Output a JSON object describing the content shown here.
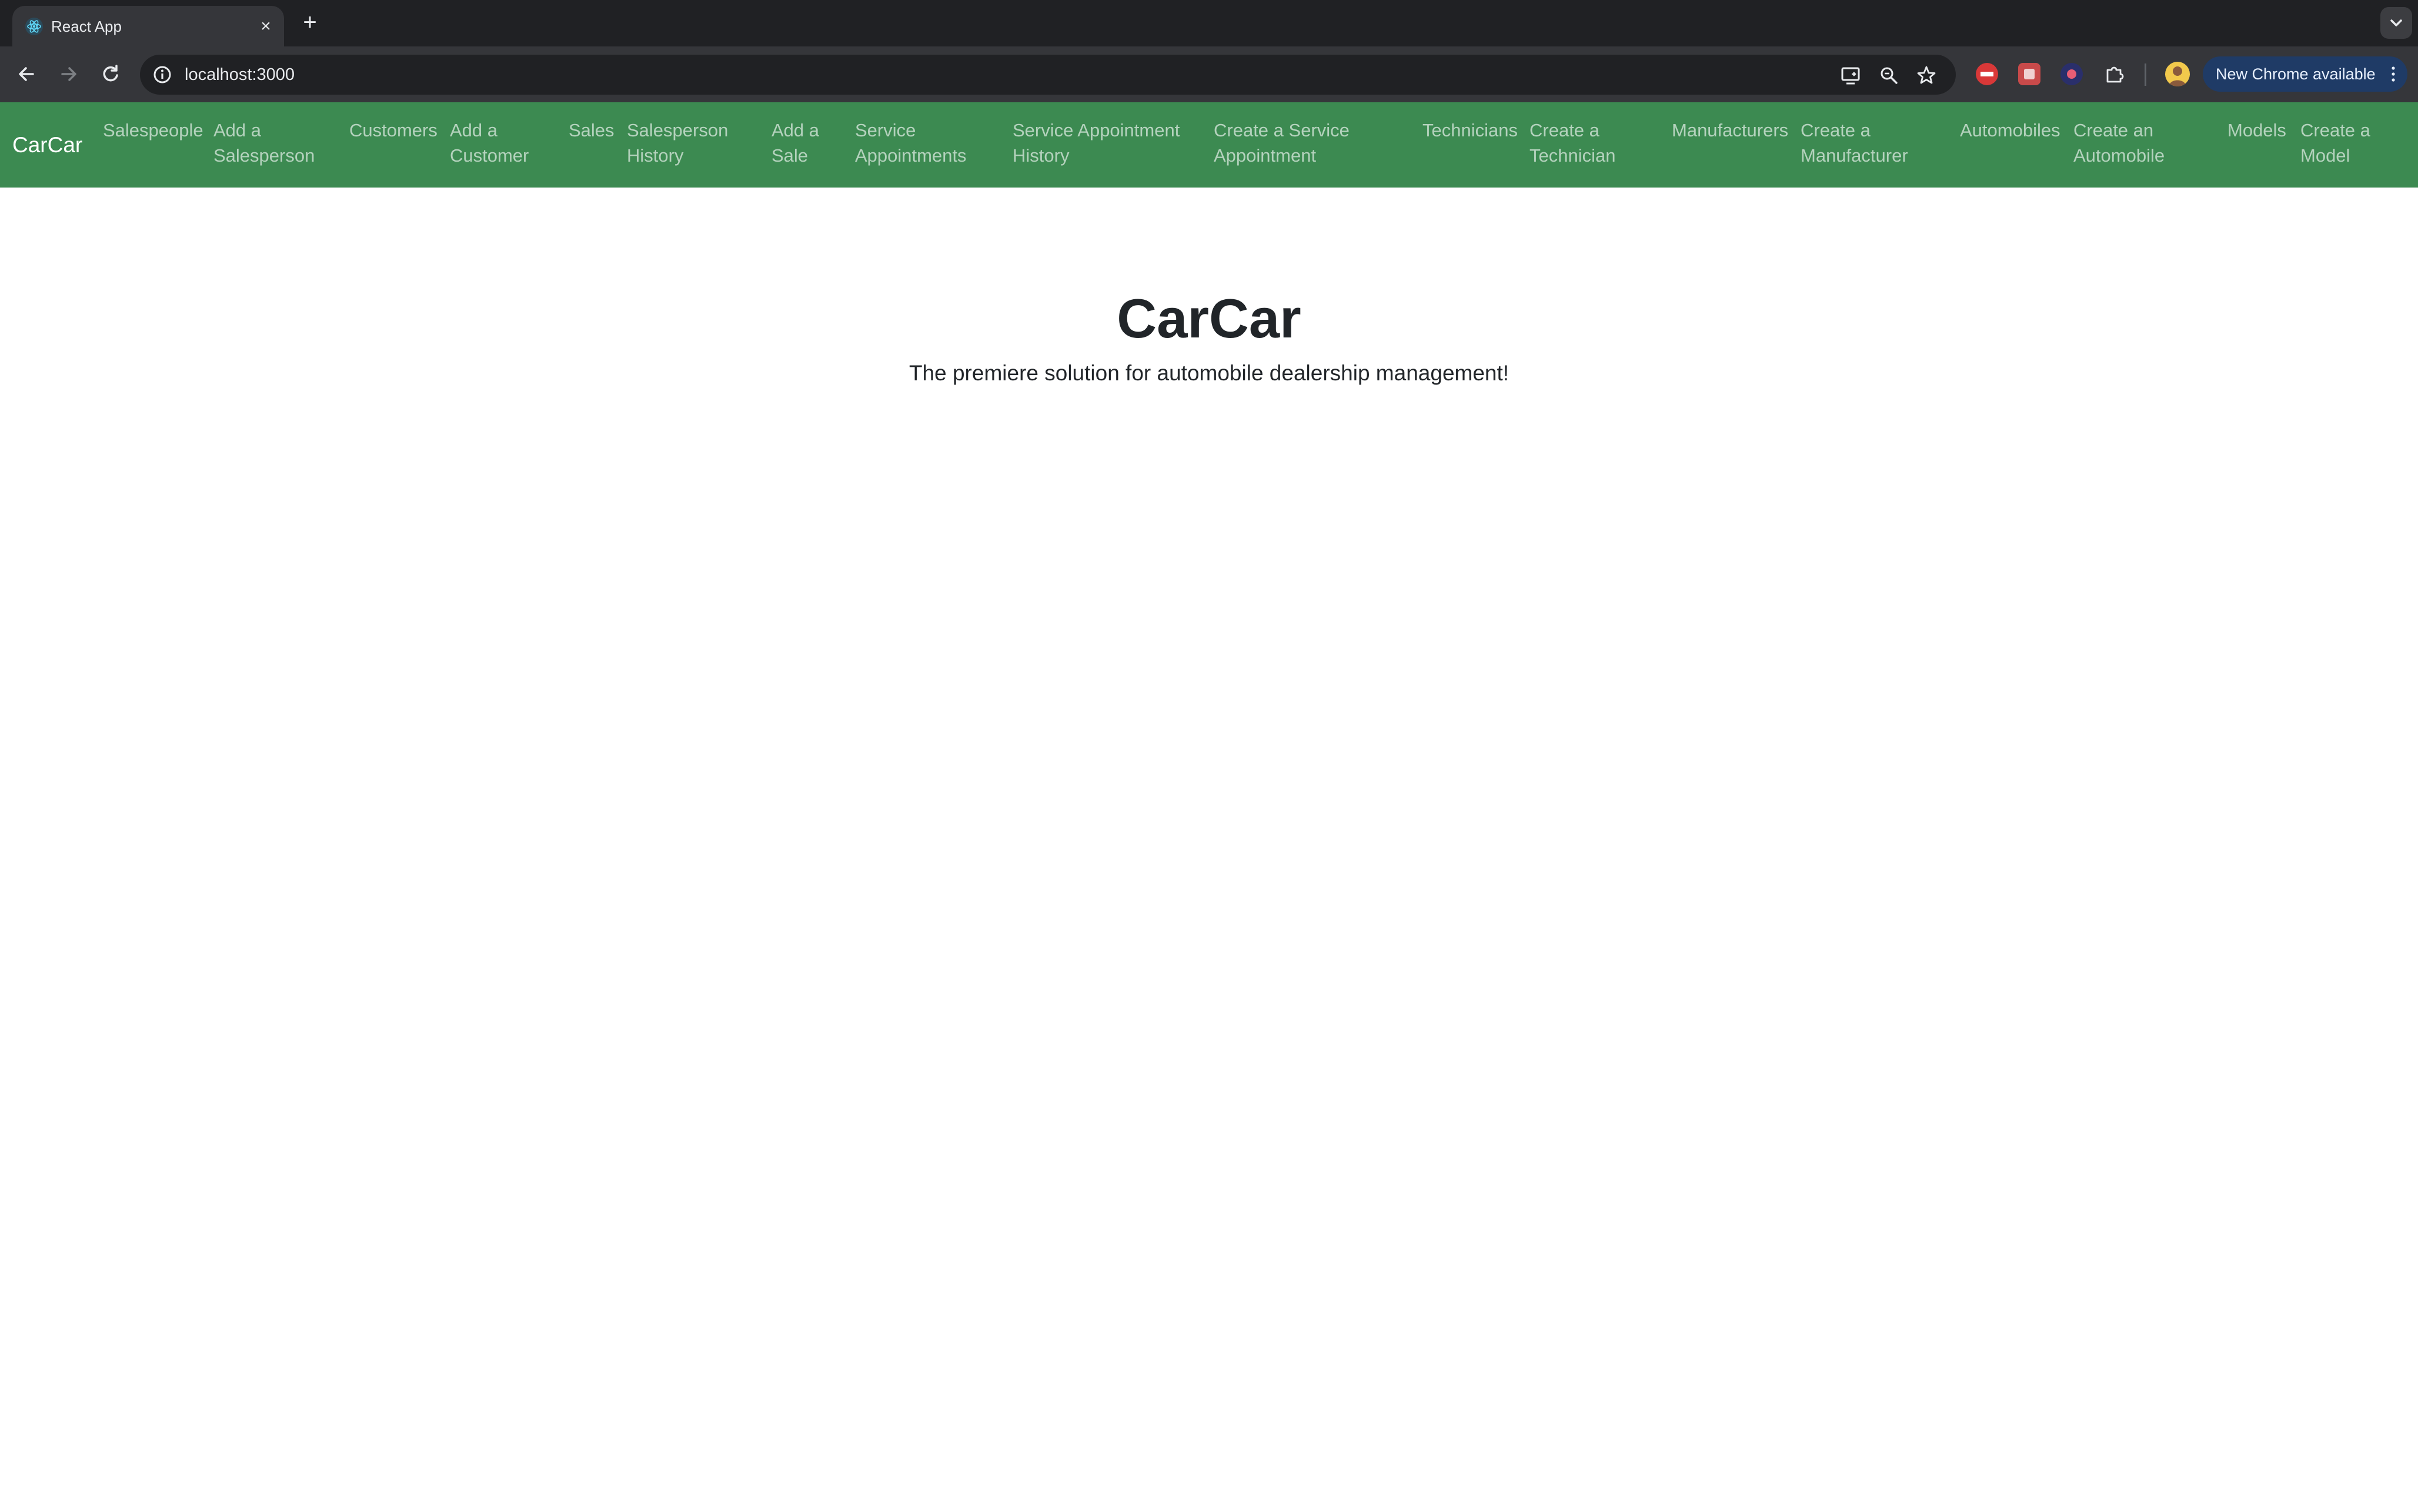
{
  "browser": {
    "tab": {
      "title": "React App",
      "close_glyph": "×"
    },
    "new_tab_glyph": "+",
    "url": "localhost:3000",
    "update_button": "New Chrome available"
  },
  "icons": {
    "favicon": "react-icon",
    "back": "arrow-left-icon",
    "forward": "arrow-right-icon",
    "reload": "reload-icon",
    "site_info": "info-icon",
    "cast": "cast-icon",
    "zoom": "zoom-icon",
    "bookmark": "star-icon",
    "extensions": "puzzle-icon",
    "menu": "kebab-icon"
  },
  "colors": {
    "navbar": "#3c8a51",
    "chrome_dark": "#202124",
    "update_pill": "#1f3b66"
  },
  "navbar": {
    "brand": "CarCar",
    "links": [
      {
        "line1": "Salespeople",
        "line2": ""
      },
      {
        "line1": "Add a",
        "line2": "Salesperson"
      },
      {
        "line1": "Customers",
        "line2": ""
      },
      {
        "line1": "Add a",
        "line2": "Customer"
      },
      {
        "line1": "Sales",
        "line2": ""
      },
      {
        "line1": "Salesperson",
        "line2": "History"
      },
      {
        "line1": "Add a",
        "line2": "Sale"
      },
      {
        "line1": "Service",
        "line2": "Appointments"
      },
      {
        "line1": "Service Appointment",
        "line2": "History"
      },
      {
        "line1": "Create a Service",
        "line2": "Appointment"
      },
      {
        "line1": "Technicians",
        "line2": ""
      },
      {
        "line1": "Create a",
        "line2": "Technician"
      },
      {
        "line1": "Manufacturers",
        "line2": ""
      },
      {
        "line1": "Create a",
        "line2": "Manufacturer"
      },
      {
        "line1": "Automobiles",
        "line2": ""
      },
      {
        "line1": "Create an",
        "line2": "Automobile"
      },
      {
        "line1": "Models",
        "line2": ""
      },
      {
        "line1": "Create a",
        "line2": "Model"
      }
    ]
  },
  "main": {
    "title": "CarCar",
    "lead": "The premiere solution for automobile dealership management!"
  }
}
